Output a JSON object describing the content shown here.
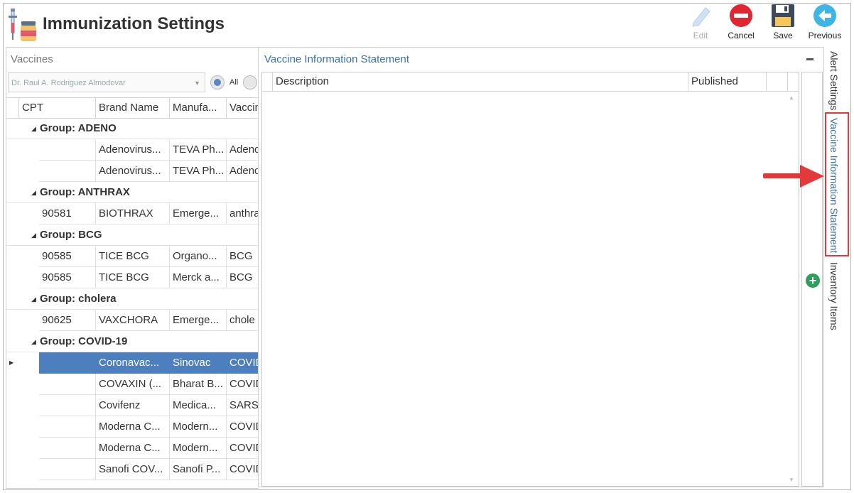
{
  "header": {
    "title": "Immunization Settings",
    "toolbar": {
      "edit_label": "Edit",
      "cancel_label": "Cancel",
      "save_label": "Save",
      "previous_label": "Previous"
    }
  },
  "left_panel": {
    "title": "Vaccines",
    "provider_value": "Dr. Raul A. Rodriguez Almodovar",
    "filter_all_label": "All",
    "columns": [
      "CPT",
      "Brand Name",
      "Manufa...",
      "Vaccin"
    ],
    "groups": [
      {
        "label": "Group: ADENO",
        "rows": [
          {
            "cpt": "",
            "brand": "Adenovirus...",
            "manu": "TEVA Ph...",
            "vacc": "Adeno"
          },
          {
            "cpt": "",
            "brand": "Adenovirus...",
            "manu": "TEVA Ph...",
            "vacc": "Adeno"
          }
        ]
      },
      {
        "label": "Group: ANTHRAX",
        "rows": [
          {
            "cpt": "90581",
            "brand": "BIOTHRAX",
            "manu": "Emerge...",
            "vacc": "anthra"
          }
        ]
      },
      {
        "label": "Group: BCG",
        "rows": [
          {
            "cpt": "90585",
            "brand": "TICE BCG",
            "manu": "Organo...",
            "vacc": "BCG"
          },
          {
            "cpt": "90585",
            "brand": "TICE BCG",
            "manu": "Merck a...",
            "vacc": "BCG"
          }
        ]
      },
      {
        "label": "Group: cholera",
        "rows": [
          {
            "cpt": "90625",
            "brand": "VAXCHORA",
            "manu": "Emerge...",
            "vacc": "chole"
          }
        ]
      },
      {
        "label": "Group: COVID-19",
        "rows": [
          {
            "cpt": "",
            "brand": "Coronavac...",
            "manu": "Sinovac",
            "vacc": "COVID",
            "selected": true
          },
          {
            "cpt": "",
            "brand": "COVAXIN (...",
            "manu": "Bharat B...",
            "vacc": "COVID"
          },
          {
            "cpt": "",
            "brand": "Covifenz",
            "manu": "Medica...",
            "vacc": "SARS-"
          },
          {
            "cpt": "",
            "brand": "Moderna C...",
            "manu": "Modern...",
            "vacc": "COVID"
          },
          {
            "cpt": "",
            "brand": "Moderna C...",
            "manu": "Modern...",
            "vacc": "COVID"
          },
          {
            "cpt": "",
            "brand": "Sanofi COV...",
            "manu": "Sanofi P...",
            "vacc": "COVID"
          }
        ]
      }
    ]
  },
  "vis_panel": {
    "title": "Vaccine Information Statement",
    "columns": [
      "Description",
      "Published"
    ]
  },
  "side_tabs": {
    "alert": "Alert Settings",
    "vis": "Vaccine Information Statement",
    "inventory": "Inventory Items"
  },
  "colors": {
    "accent": "#3a6fb0",
    "selection": "#4d7fbf",
    "highlight_box": "#e23a3a",
    "add_button": "#2e9e5b"
  }
}
